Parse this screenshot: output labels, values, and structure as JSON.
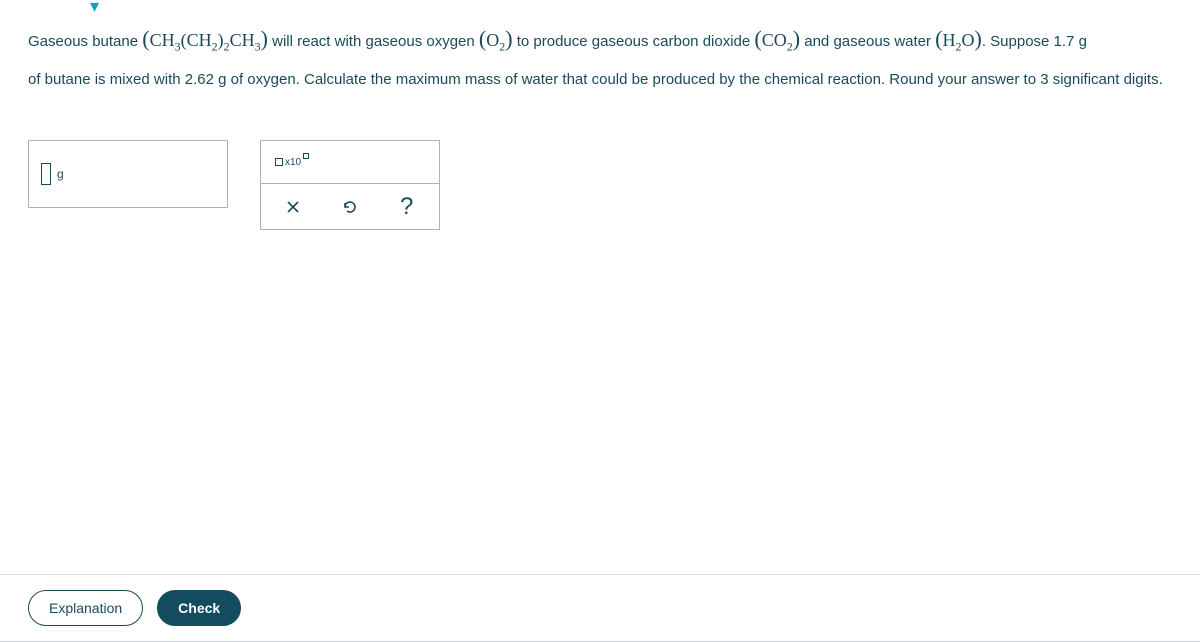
{
  "prompt": {
    "text1": "Gaseous butane ",
    "formula_butane": "CH3(CH2)2CH3",
    "text2": " will react with gaseous oxygen ",
    "formula_o2": "O2",
    "text3": " to produce gaseous carbon dioxide ",
    "formula_co2": "CO2",
    "text4": " and gaseous water ",
    "formula_h2o": "H2O",
    "text5": ". Suppose 1.7 g",
    "line2": "of butane is mixed with 2.62 g of oxygen. Calculate the maximum mass of water that could be produced by the chemical reaction. Round your answer to 3 significant digits."
  },
  "answer": {
    "input_value": "",
    "unit": "g"
  },
  "toolpanel": {
    "sci_label": "x10"
  },
  "buttons": {
    "explanation": "Explanation",
    "check": "Check"
  }
}
